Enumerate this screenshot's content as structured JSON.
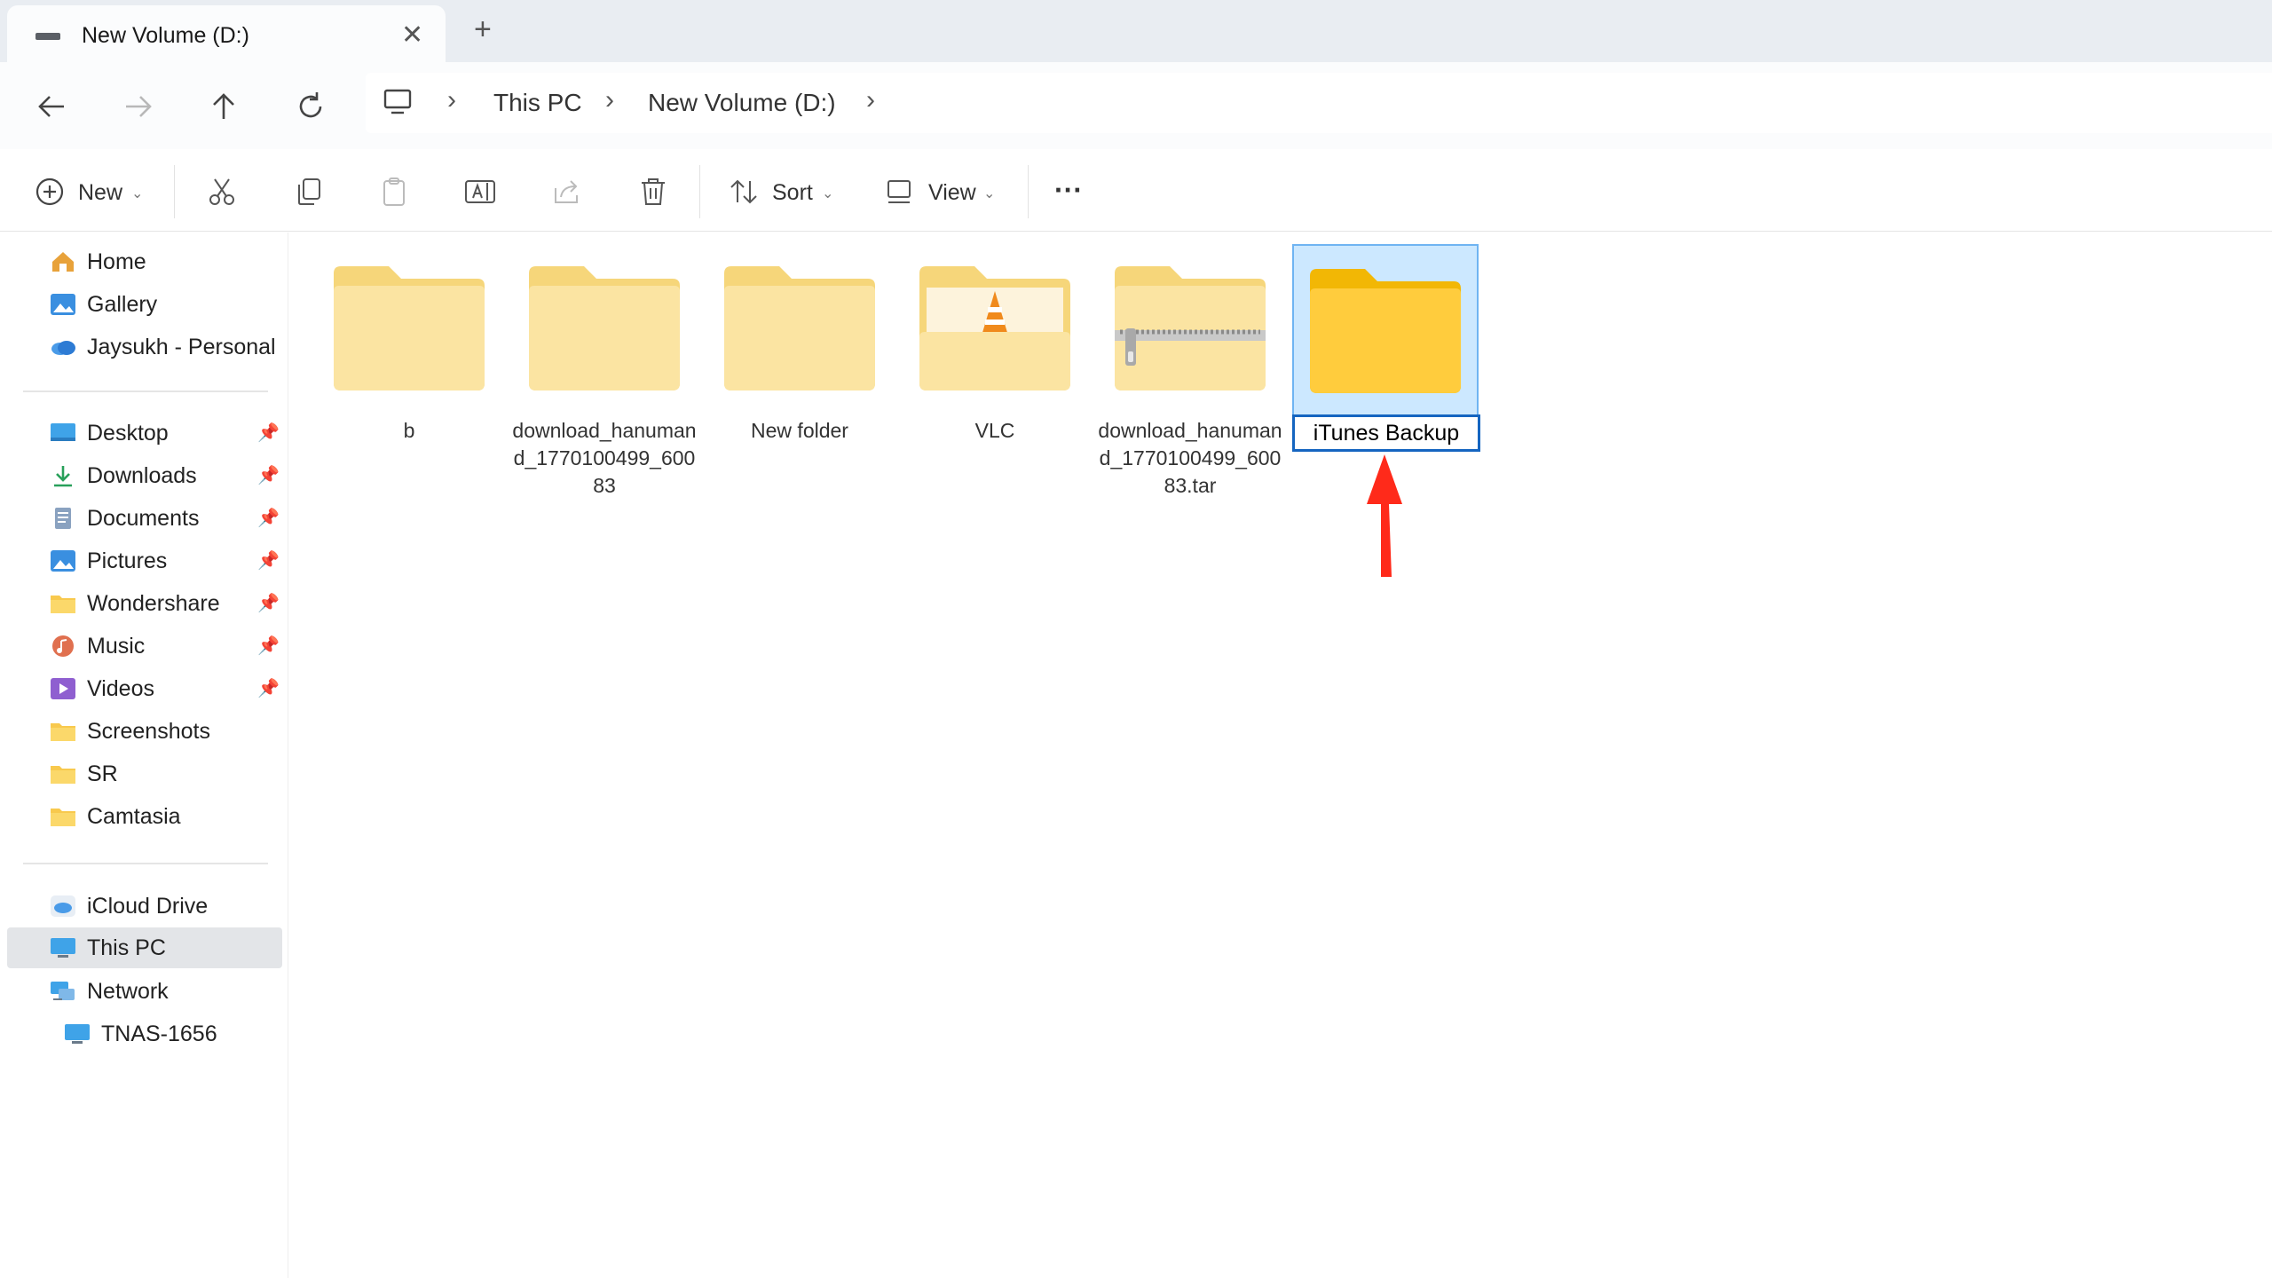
{
  "window": {
    "tab_title": "New Volume (D:)",
    "tab_close": "✕",
    "new_tab": "+"
  },
  "address": {
    "crumbs": [
      "This PC",
      "New Volume (D:)"
    ]
  },
  "toolbar": {
    "new_label": "New",
    "sort_label": "Sort",
    "view_label": "View",
    "more": "···"
  },
  "sidebar": {
    "quick": [
      "Home",
      "Gallery",
      "Jaysukh - Personal"
    ],
    "pinned": [
      "Desktop",
      "Downloads",
      "Documents",
      "Pictures",
      "Wondershare",
      "Music",
      "Videos",
      "Screenshots",
      "SR",
      "Camtasia"
    ],
    "places": [
      "iCloud Drive",
      "This PC",
      "Network",
      "TNAS-1656"
    ],
    "selected": "This PC"
  },
  "items": [
    {
      "name": "b",
      "type": "folder"
    },
    {
      "name": "download_hanumand_1770100499_60083",
      "type": "folder"
    },
    {
      "name": "New folder",
      "type": "folder"
    },
    {
      "name": "VLC",
      "type": "folder-vlc"
    },
    {
      "name": "download_hanumand_1770100499_60083.tar",
      "type": "archive"
    },
    {
      "name": "iTunes Backup",
      "type": "folder",
      "state": "renaming"
    }
  ],
  "colors": {
    "folder_light": "#fbe3a0",
    "folder_bright": "#ffc83d",
    "selection": "#cce8ff",
    "annotation_arrow": "#ff2a1a"
  }
}
